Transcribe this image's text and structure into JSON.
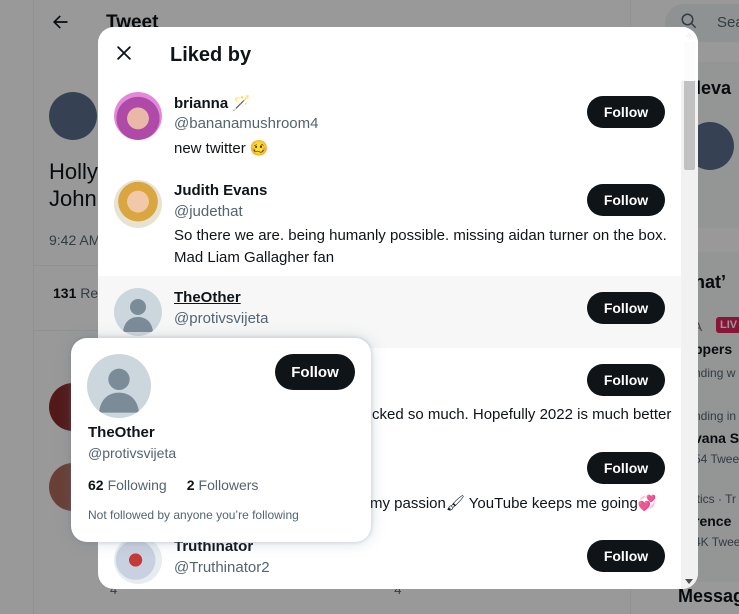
{
  "background": {
    "header_title": "Tweet",
    "tweet_text_lines": [
      "Holly",
      "John"
    ],
    "tweet_time": "9:42 AM",
    "stats_count": "131",
    "stats_label": "Re",
    "action_counts": [
      "4",
      "",
      "4",
      ""
    ],
    "search_placeholder": "Sea",
    "sidebar": {
      "relevant_heading": "eleva",
      "whats_heading": "hat’",
      "trend1_meta": "A",
      "trend1_live": "LIV",
      "trend1_name": "ppers",
      "trend1_sub": "nding w",
      "trend2_meta": "nding in",
      "trend2_name": "vana S",
      "trend2_count": "54 Twee",
      "trend3_meta": "itics · Tr",
      "trend3_name": "rence",
      "trend3_count": "4K Twee",
      "messages_heading": "Messag"
    }
  },
  "modal": {
    "title": "Liked by",
    "users": [
      {
        "name": "brianna 🪄",
        "handle": "@bananamushroom4",
        "bio": "new twitter 🥴",
        "follow_label": "Follow"
      },
      {
        "name": "Judith Evans",
        "handle": "@judethat",
        "bio": "So there we are. being humanly possible. missing aidan turner on the box. Mad Liam Gallagher fan",
        "follow_label": "Follow"
      },
      {
        "name": "TheOther",
        "handle": "@protivsvijeta",
        "bio": "",
        "follow_label": "Follow"
      },
      {
        "name": "",
        "handle": "",
        "bio": "cked so much. Hopefully 2022 is much better",
        "follow_label": "Follow"
      },
      {
        "name": "",
        "handle": "",
        "bio": "my passion🖌 YouTube keeps me going💞",
        "follow_label": "Follow"
      },
      {
        "name": "Truthinator",
        "handle": "@Truthinator2",
        "bio": "",
        "follow_label": "Follow"
      }
    ]
  },
  "hovercard": {
    "name": "TheOther",
    "handle": "@protivsvijeta",
    "following_count": "62",
    "following_label": "Following",
    "followers_count": "2",
    "followers_label": "Followers",
    "note": "Not followed by anyone you’re following",
    "follow_label": "Follow"
  },
  "colors": {
    "accent_dark": "#0f1419",
    "secondary_text": "#536471",
    "live_badge": "#e0245e"
  }
}
